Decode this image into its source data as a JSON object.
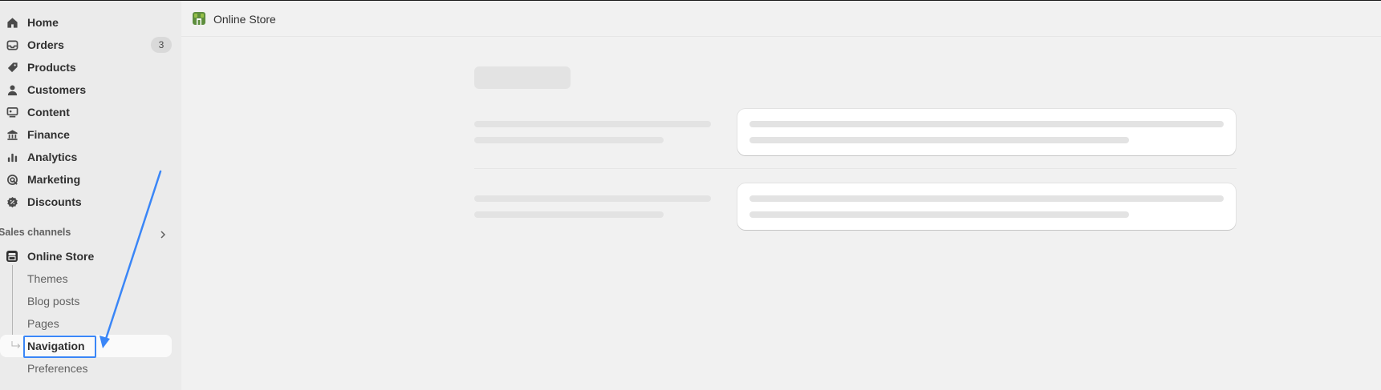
{
  "sidebar": {
    "items": [
      {
        "label": "Home",
        "icon": "home-icon"
      },
      {
        "label": "Orders",
        "icon": "inbox-icon",
        "badge": "3"
      },
      {
        "label": "Products",
        "icon": "tag-icon"
      },
      {
        "label": "Customers",
        "icon": "person-icon"
      },
      {
        "label": "Content",
        "icon": "content-icon"
      },
      {
        "label": "Finance",
        "icon": "bank-icon"
      },
      {
        "label": "Analytics",
        "icon": "bar-chart-icon"
      },
      {
        "label": "Marketing",
        "icon": "target-icon"
      },
      {
        "label": "Discounts",
        "icon": "discount-icon"
      }
    ],
    "sales_channels": {
      "title": "Sales channels",
      "store": {
        "label": "Online Store",
        "icon": "store-icon"
      },
      "sub_items": [
        "Themes",
        "Blog posts",
        "Pages",
        "Navigation",
        "Preferences"
      ],
      "active": "Navigation"
    }
  },
  "topbar": {
    "title": "Online Store"
  },
  "colors": {
    "highlight": "#3a86f7",
    "sidebar_bg": "#ebebeb",
    "page_bg": "#f1f1f1",
    "logo_green": "#5e8e3e"
  }
}
